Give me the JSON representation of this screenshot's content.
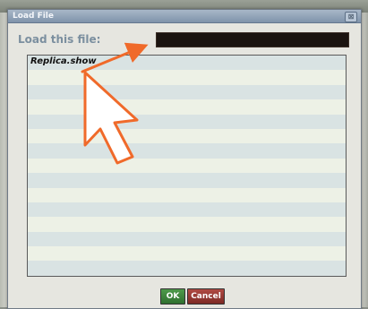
{
  "window": {
    "title": "Load File",
    "close_glyph": "⊠"
  },
  "form": {
    "label": "Load this file:",
    "file_value": ""
  },
  "file_list": {
    "items": [
      "Replica.show",
      "",
      "",
      "",
      "",
      "",
      "",
      "",
      "",
      "",
      "",
      "",
      "",
      "",
      ""
    ]
  },
  "buttons": {
    "ok_label": "OK",
    "cancel_label": "Cancel"
  },
  "colors": {
    "annotation_arrow": "#f06a2a",
    "pointer_outline": "#f06a2a",
    "ok": "#3f8a3d",
    "cancel": "#9a3a34"
  },
  "icons": {
    "close": "close-icon",
    "annotation_arrow": "orange-arrow-icon",
    "pointer": "mouse-pointer-icon"
  }
}
